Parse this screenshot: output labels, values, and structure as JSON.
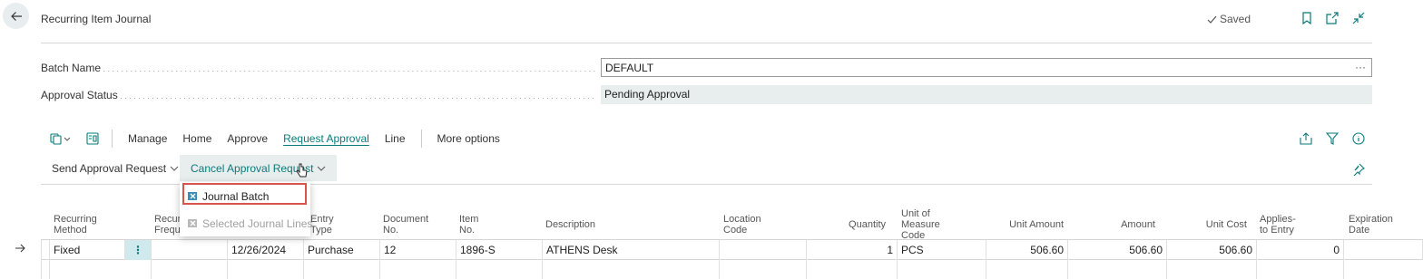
{
  "page": {
    "title": "Recurring Item Journal",
    "saved_label": "Saved"
  },
  "fields": [
    {
      "label": "Batch Name",
      "value": "DEFAULT",
      "assist": "···"
    },
    {
      "label": "Approval Status",
      "value": "Pending Approval"
    }
  ],
  "actions": [
    "Manage",
    "Home",
    "Approve",
    "Request Approval",
    "Line",
    "More options"
  ],
  "active_action": "Request Approval",
  "subactions": {
    "send": "Send Approval Request",
    "cancel": "Cancel Approval Request"
  },
  "dropdown": {
    "items": [
      "Journal Batch",
      "Selected Journal Lines"
    ],
    "highlighted": "Journal Batch",
    "disabled": [
      "Selected Journal Lines"
    ]
  },
  "columns": {
    "recurring_method": [
      "Recurring",
      "Method"
    ],
    "recurring_freq": [
      "Recurr",
      "Freque"
    ],
    "entry_type": "Entry Type",
    "document_no": "Document No.",
    "item_no": "Item No.",
    "description": "Description",
    "location_code": "Location Code",
    "quantity": "Quantity",
    "uom": [
      "Unit of Measure",
      "Code"
    ],
    "unit_amount": "Unit Amount",
    "amount": "Amount",
    "unit_cost": "Unit Cost",
    "applies_to_entry": "Applies-to Entry",
    "expiration_date": "Expiration Date"
  },
  "rows": [
    {
      "recurring_method": "Fixed",
      "posting_date": "12/26/2024",
      "entry_type": "Purchase",
      "document_no": "12",
      "item_no": "1896-S",
      "description": "ATHENS Desk",
      "quantity": "1",
      "uom": "PCS",
      "unit_amount": "506.60",
      "amount": "506.60",
      "unit_cost": "506.60",
      "applies_to_entry": "0"
    }
  ],
  "colors": {
    "accent": "#0a7a7a",
    "highlight_border": "#d9534f",
    "status_bg": "#e8edee"
  }
}
